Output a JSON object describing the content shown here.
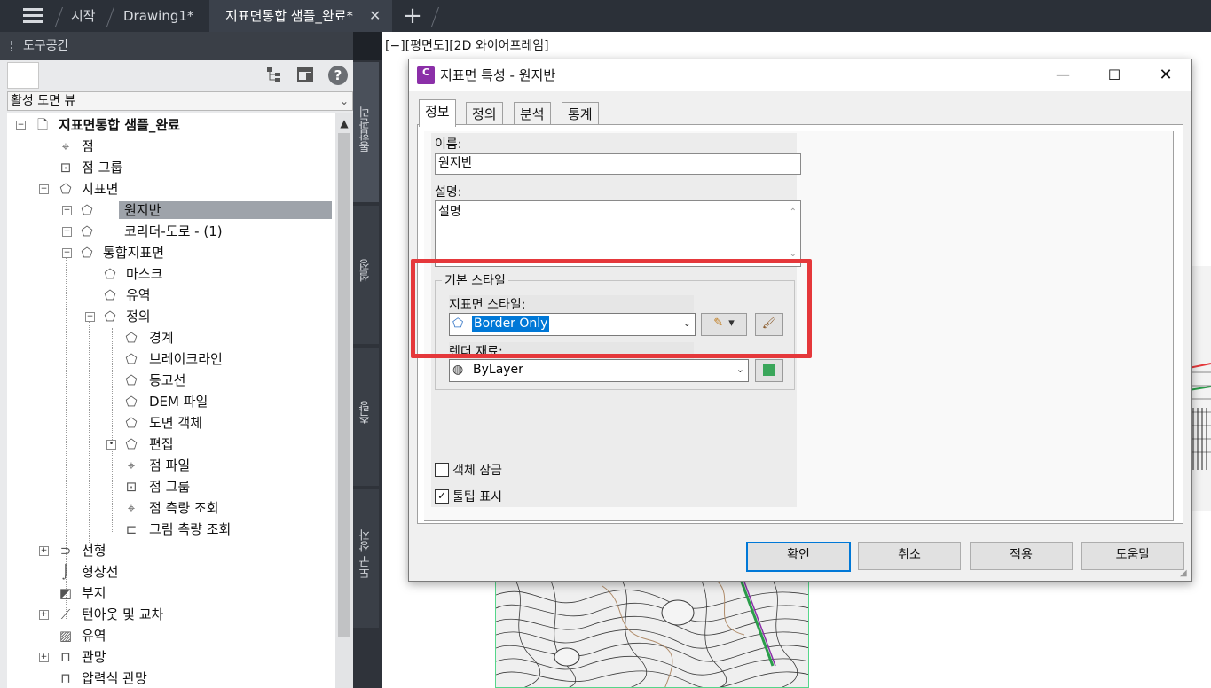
{
  "topbar": {
    "tabs": [
      {
        "label": "시작"
      },
      {
        "label": "Drawing1*"
      },
      {
        "label": "지표면통합 샘플_완료*"
      }
    ],
    "close_glyph": "✕",
    "add_glyph": "+"
  },
  "toolspace": {
    "title": "도구공간",
    "view_select": "활성 도면 뷰",
    "help_glyph": "?",
    "tree": [
      {
        "label": "지표면통합 샘플_완료",
        "icon": "drawing-icon",
        "bold": true
      },
      {
        "label": "점",
        "icon": "point-icon"
      },
      {
        "label": "점 그룹",
        "icon": "point-group-icon"
      },
      {
        "label": "지표면",
        "icon": "surface-icon"
      },
      {
        "label": "원지반",
        "icon": "surface-icon",
        "selected": true
      },
      {
        "label": "코리더-도로 - (1)",
        "icon": "surface-icon"
      },
      {
        "label": "통합지표면",
        "icon": "surface-icon"
      },
      {
        "label": "마스크",
        "icon": "mask-icon"
      },
      {
        "label": "유역",
        "icon": "watershed-icon"
      },
      {
        "label": "정의",
        "icon": "definition-icon"
      },
      {
        "label": "경계",
        "icon": "boundary-icon"
      },
      {
        "label": "브레이크라인",
        "icon": "breakline-icon"
      },
      {
        "label": "등고선",
        "icon": "contour-icon"
      },
      {
        "label": "DEM 파일",
        "icon": "dem-icon"
      },
      {
        "label": "도면 객체",
        "icon": "drawing-object-icon"
      },
      {
        "label": "편집",
        "icon": "edit-icon"
      },
      {
        "label": "점 파일",
        "icon": "point-file-icon"
      },
      {
        "label": "점 그룹",
        "icon": "point-group-icon"
      },
      {
        "label": "점 측량 조회",
        "icon": "point-survey-icon"
      },
      {
        "label": "그림 측량 조회",
        "icon": "figure-survey-icon"
      },
      {
        "label": "선형",
        "icon": "alignment-icon"
      },
      {
        "label": "형상선",
        "icon": "feature-line-icon"
      },
      {
        "label": "부지",
        "icon": "site-icon"
      },
      {
        "label": "턴아웃 및 교차",
        "icon": "turnout-icon"
      },
      {
        "label": "유역",
        "icon": "catchment-icon"
      },
      {
        "label": "관망",
        "icon": "pipe-network-icon"
      },
      {
        "label": "압력식 관망",
        "icon": "pressure-network-icon"
      }
    ]
  },
  "sidetabs": [
    "통합관리",
    "설정",
    "측량",
    "도구 상자"
  ],
  "viewport": {
    "label": "[−][평면도][2D 와이어프레임]"
  },
  "dialog": {
    "title": "지표면 특성 - 원지반",
    "icon_text": "C",
    "tabs": [
      "정보",
      "정의",
      "분석",
      "통계"
    ],
    "name_label": "이름:",
    "name_value": "원지반",
    "desc_label": "설명:",
    "desc_value": "설명",
    "group_title": "기본 스타일",
    "style_label": "지표면 스타일:",
    "style_value": "Border Only",
    "render_label": "렌더 재료:",
    "render_value": "ByLayer",
    "lock_label": "객체 잠금",
    "lock_checked": false,
    "tooltip_label": "툴팁 표시",
    "tooltip_checked": true,
    "buttons": {
      "ok": "확인",
      "cancel": "취소",
      "apply": "적용",
      "help": "도움말"
    }
  },
  "colors": {
    "highlight": "#e5383b",
    "accent": "#0078d7",
    "selection": "#0078d7"
  }
}
